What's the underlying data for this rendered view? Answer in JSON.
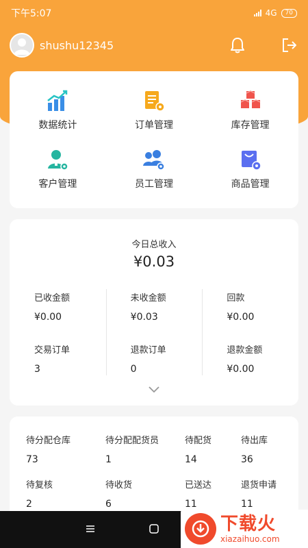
{
  "status_bar": {
    "time": "下午5:07",
    "network": "4G",
    "battery": "70"
  },
  "header": {
    "username": "shushu12345"
  },
  "menu": [
    {
      "label": "数据统计",
      "icon": "chart-icon"
    },
    {
      "label": "订单管理",
      "icon": "order-icon"
    },
    {
      "label": "库存管理",
      "icon": "inventory-icon"
    },
    {
      "label": "客户管理",
      "icon": "customer-icon"
    },
    {
      "label": "员工管理",
      "icon": "staff-icon"
    },
    {
      "label": "商品管理",
      "icon": "product-icon"
    }
  ],
  "income": {
    "title": "今日总收入",
    "value": "¥0.03",
    "stats": [
      {
        "label": "已收金额",
        "value": "¥0.00"
      },
      {
        "label": "交易订单",
        "value": "3"
      },
      {
        "label": "未收金额",
        "value": "¥0.03"
      },
      {
        "label": "退款订单",
        "value": "0"
      },
      {
        "label": "回款",
        "value": "¥0.00"
      },
      {
        "label": "退款金额",
        "value": "¥0.00"
      }
    ]
  },
  "orders": [
    {
      "label": "待分配仓库",
      "value": "73"
    },
    {
      "label": "待分配配货员",
      "value": "1"
    },
    {
      "label": "待配货",
      "value": "14"
    },
    {
      "label": "待出库",
      "value": "36"
    },
    {
      "label": "待复核",
      "value": "2"
    },
    {
      "label": "待收货",
      "value": "6"
    },
    {
      "label": "已送达",
      "value": "11"
    },
    {
      "label": "退货申请",
      "value": "11"
    }
  ],
  "watermark": {
    "title": "下载火",
    "subtitle": "xiazaihuo.com"
  },
  "colors": {
    "accent": "#f9a43b",
    "watermark": "#f04a2c"
  }
}
